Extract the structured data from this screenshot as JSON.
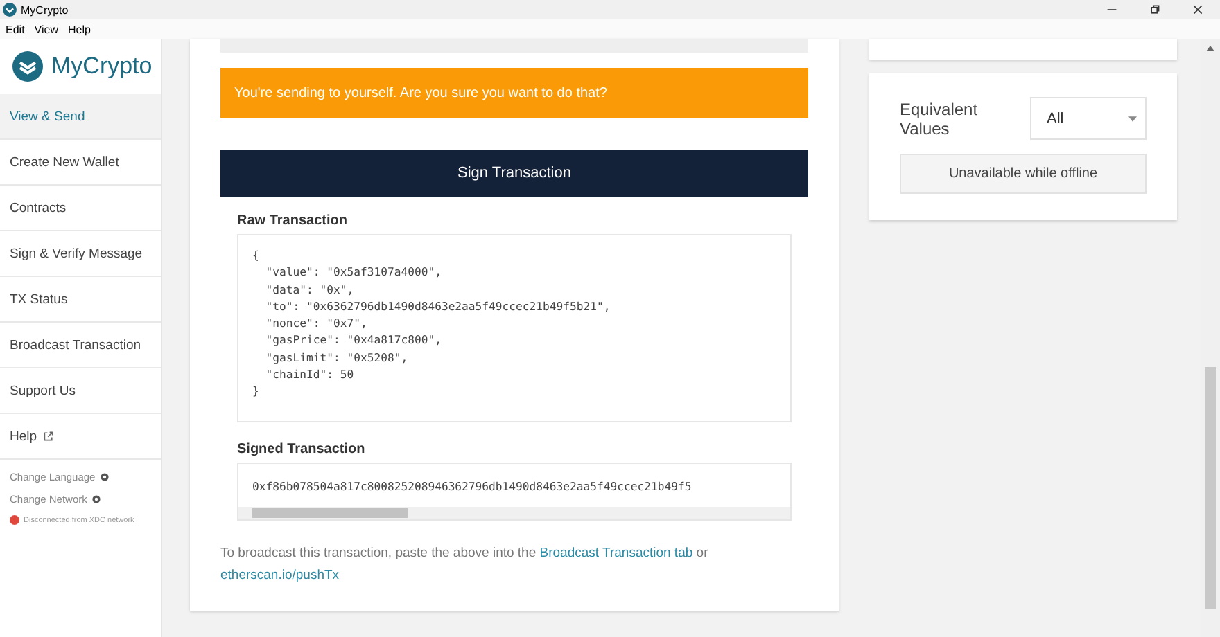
{
  "window": {
    "title": "MyCrypto"
  },
  "menu": [
    "Edit",
    "View",
    "Help"
  ],
  "sidebar": {
    "logo": "MyCrypto",
    "items": [
      {
        "label": "View & Send",
        "selected": true
      },
      {
        "label": "Create New Wallet",
        "selected": false
      },
      {
        "label": "Contracts",
        "selected": false
      },
      {
        "label": "Sign & Verify Message",
        "selected": false
      },
      {
        "label": "TX Status",
        "selected": false
      },
      {
        "label": "Broadcast Transaction",
        "selected": false
      },
      {
        "label": "Support Us",
        "selected": false
      },
      {
        "label": "Help",
        "selected": false,
        "external": true
      }
    ],
    "settings": [
      "Change Language",
      "Change Network"
    ],
    "status": {
      "text": "Disconnected from XDC network",
      "color": "#e0483c"
    }
  },
  "main": {
    "warning": "You're sending to yourself. Are you sure you want to do that?",
    "sign_button": "Sign Transaction",
    "raw_label": "Raw Transaction",
    "raw_lines": [
      "{",
      "  \"value\": \"0x5af3107a4000\",",
      "  \"data\": \"0x\",",
      "  \"to\": \"0x6362796db1490d8463e2aa5f49ccec21b49f5b21\",",
      "  \"nonce\": \"0x7\",",
      "  \"gasPrice\": \"0x4a817c800\",",
      "  \"gasLimit\": \"0x5208\",",
      "  \"chainId\": 50",
      "}"
    ],
    "signed_label": "Signed Transaction",
    "signed_value": "0xf86b078504a817c800825208946362796db1490d8463e2aa5f49ccec21b49f5",
    "footer": {
      "before": "To broadcast this transaction, paste the above into the ",
      "link1": "Broadcast Transaction tab",
      "middle": " or ",
      "link2": "etherscan.io/pushTx"
    }
  },
  "side_panel": {
    "label": "Equivalent Values",
    "select": "All",
    "button": "Unavailable while offline"
  }
}
